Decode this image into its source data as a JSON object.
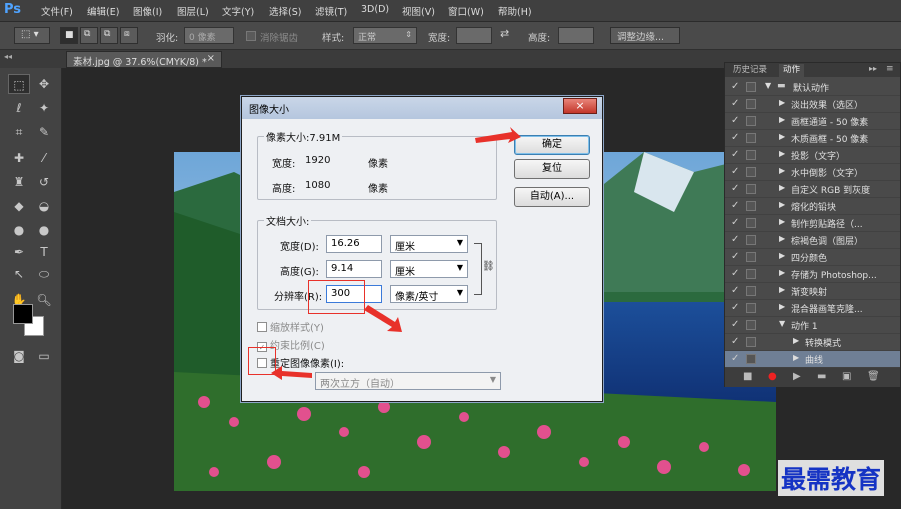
{
  "app": {
    "logo": "Ps"
  },
  "menu": [
    "文件(F)",
    "编辑(E)",
    "图像(I)",
    "图层(L)",
    "文字(Y)",
    "选择(S)",
    "滤镜(T)",
    "3D(D)",
    "视图(V)",
    "窗口(W)",
    "帮助(H)"
  ],
  "options": {
    "feather_label": "羽化:",
    "feather_value": "0 像素",
    "antialias_label": "消除锯齿",
    "style_label": "样式:",
    "style_value": "正常",
    "width_label": "宽度:",
    "height_label": "高度:",
    "refine_label": "调整边缘..."
  },
  "document": {
    "tab": "素材.jpg @ 37.6%(CMYK/8) *",
    "close": "×"
  },
  "panel": {
    "tab_history": "历史记录",
    "tab_actions": "动作",
    "actions": [
      {
        "label": "默认动作",
        "level": 0,
        "folder": true
      },
      {
        "label": "淡出效果（选区）",
        "level": 1
      },
      {
        "label": "画框通道 - 50 像素",
        "level": 1
      },
      {
        "label": "木质画框 - 50 像素",
        "level": 1
      },
      {
        "label": "投影（文字）",
        "level": 1
      },
      {
        "label": "水中倒影（文字）",
        "level": 1
      },
      {
        "label": "自定义 RGB 到灰度",
        "level": 1
      },
      {
        "label": "熔化的铅块",
        "level": 1
      },
      {
        "label": "制作剪贴路径（...",
        "level": 1
      },
      {
        "label": "棕褐色调（图层）",
        "level": 1
      },
      {
        "label": "四分颜色",
        "level": 1
      },
      {
        "label": "存储为 Photoshop...",
        "level": 1
      },
      {
        "label": "渐变映射",
        "level": 1
      },
      {
        "label": "混合器画笔克隆...",
        "level": 1
      },
      {
        "label": "动作 1",
        "level": 1,
        "expanded": true
      },
      {
        "label": "转换模式",
        "level": 2
      },
      {
        "label": "曲线",
        "level": 2,
        "selected": true
      }
    ]
  },
  "dialog": {
    "title": "图像大小",
    "close": "×",
    "pixel_size_label": "像素大小:7.91M",
    "width_label": "宽度:",
    "width_value": "1920",
    "width_unit": "像素",
    "height_label": "高度:",
    "height_value": "1080",
    "height_unit": "像素",
    "doc_size_label": "文档大小:",
    "doc_width_label": "宽度(D):",
    "doc_width_value": "16.26",
    "doc_width_unit": "厘米",
    "doc_height_label": "高度(G):",
    "doc_height_value": "9.14",
    "doc_height_unit": "厘米",
    "resolution_label": "分辨率(R):",
    "resolution_value": "300",
    "resolution_unit": "像素/英寸",
    "scale_styles": "缩放样式(Y)",
    "constrain": "约束比例(C)",
    "resample": "重定图像像素(I):",
    "resample_method": "两次立方（自动）",
    "ok": "确定",
    "reset": "复位",
    "auto": "自动(A)..."
  },
  "watermark": "最需教育",
  "colors": {
    "accent_red": "#e8312a",
    "ps_blue": "#4fa3ff",
    "watermark_blue": "#1533c4"
  }
}
